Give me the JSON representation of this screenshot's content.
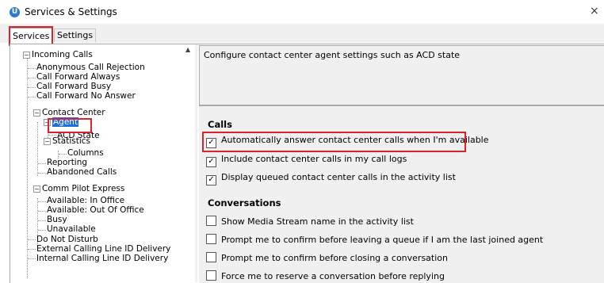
{
  "window": {
    "title": "Services & Settings",
    "icon_label": "U",
    "close_label": "×"
  },
  "tabs": [
    {
      "label": "Services"
    },
    {
      "label": "Settings"
    }
  ],
  "tree": {
    "items": [
      {
        "label": "Incoming Calls",
        "expander": "−"
      },
      {
        "label": "Anonymous Call Rejection"
      },
      {
        "label": "Call Forward Always"
      },
      {
        "label": "Call Forward Busy"
      },
      {
        "label": "Call Forward No Answer"
      },
      {
        "label": "Contact Center",
        "expander": "−"
      },
      {
        "label": "Agent",
        "expander": "−",
        "selected": true
      },
      {
        "label": "ACD State"
      },
      {
        "label": "Statistics",
        "expander": "−"
      },
      {
        "label": "Columns"
      },
      {
        "label": "Reporting"
      },
      {
        "label": "Abandoned Calls"
      },
      {
        "label": "Comm Pilot Express",
        "expander": "−"
      },
      {
        "label": "Available: In Office"
      },
      {
        "label": "Available: Out Of Office"
      },
      {
        "label": "Busy"
      },
      {
        "label": "Unavailable"
      },
      {
        "label": "Do Not Disturb"
      },
      {
        "label": "External Calling Line ID Delivery"
      },
      {
        "label": "Internal Calling Line ID Delivery"
      }
    ]
  },
  "description": "Configure contact center agent settings such as ACD state",
  "calls": {
    "heading": "Calls",
    "options": [
      {
        "label": "Automatically answer contact center calls when I'm available",
        "checked": true,
        "check": "✓"
      },
      {
        "label": "Include contact center calls in my call logs",
        "checked": true,
        "check": "✓"
      },
      {
        "label": "Display queued contact center calls in the activity list",
        "checked": true,
        "check": "✓"
      }
    ]
  },
  "conversations": {
    "heading": "Conversations",
    "options": [
      {
        "label": "Show Media Stream name in the activity list",
        "checked": false,
        "check": ""
      },
      {
        "label": "Prompt me to confirm before leaving a queue if I am the last joined agent",
        "checked": false,
        "check": ""
      },
      {
        "label": "Prompt me to confirm before closing a conversation",
        "checked": false,
        "check": ""
      },
      {
        "label": "Force me to reserve a conversation before replying",
        "checked": false,
        "check": ""
      }
    ]
  },
  "colors": {
    "accent": "#1e6fd9",
    "highlight": "#d9232d",
    "app_icon": "#2a7bd3"
  }
}
